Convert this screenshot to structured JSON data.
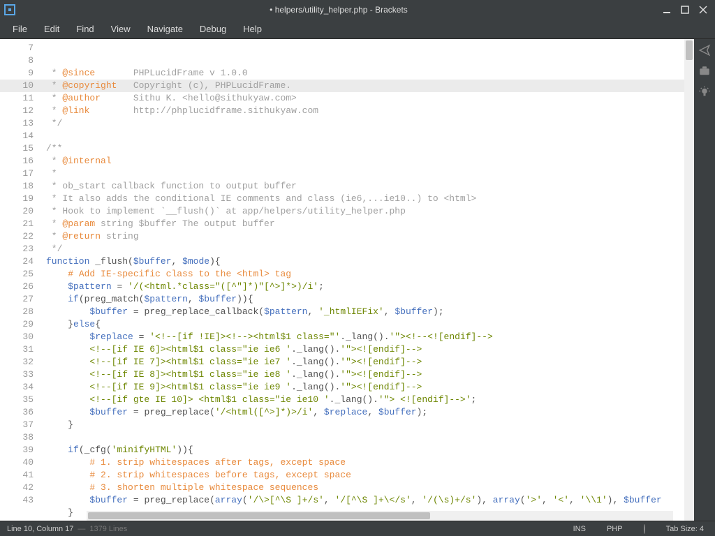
{
  "window": {
    "title": "• helpers/utility_helper.php - Brackets"
  },
  "menu": [
    "File",
    "Edit",
    "Find",
    "View",
    "Navigate",
    "Debug",
    "Help"
  ],
  "editor": {
    "first_line": 7,
    "last_line": 43,
    "active_line": 10,
    "lines": {
      "7": [
        [
          "c-gray",
          " * "
        ],
        [
          "c-orange",
          "@since"
        ],
        [
          "c-gray",
          "       PHPLucidFrame v 1.0.0"
        ]
      ],
      "8": [
        [
          "c-gray",
          " * "
        ],
        [
          "c-orange",
          "@copyright"
        ],
        [
          "c-gray",
          "   Copyright (c), PHPLucidFrame."
        ]
      ],
      "9": [
        [
          "c-gray",
          " * "
        ],
        [
          "c-orange",
          "@author"
        ],
        [
          "c-gray",
          "      Sithu K. <hello@sithukyaw.com>"
        ]
      ],
      "10": [
        [
          "c-gray",
          " * "
        ],
        [
          "c-orange",
          "@link"
        ],
        [
          "c-gray",
          "        http://phplucidframe.sithukyaw.com"
        ]
      ],
      "11": [
        [
          "c-gray",
          " */"
        ]
      ],
      "12": [
        [
          "c-gray",
          ""
        ]
      ],
      "13": [
        [
          "c-gray",
          "/**"
        ]
      ],
      "14": [
        [
          "c-gray",
          " * "
        ],
        [
          "c-orange",
          "@internal"
        ]
      ],
      "15": [
        [
          "c-gray",
          " *"
        ]
      ],
      "16": [
        [
          "c-gray",
          " * ob_start callback function to output buffer"
        ]
      ],
      "17": [
        [
          "c-gray",
          " * It also adds the conditional IE comments and class (ie6,...ie10..) to <html>"
        ]
      ],
      "18": [
        [
          "c-gray",
          " * Hook to implement `__flush()` at app/helpers/utility_helper.php"
        ]
      ],
      "19": [
        [
          "c-gray",
          " * "
        ],
        [
          "c-orange",
          "@param"
        ],
        [
          "c-gray",
          " string $buffer The output buffer"
        ]
      ],
      "20": [
        [
          "c-gray",
          " * "
        ],
        [
          "c-orange",
          "@return"
        ],
        [
          "c-gray",
          " string"
        ]
      ],
      "21": [
        [
          "c-gray",
          " */"
        ]
      ],
      "22": [
        [
          "c-kw",
          "function"
        ],
        [
          "c-black",
          " "
        ],
        [
          "c-fn",
          "_flush"
        ],
        [
          "c-black",
          "("
        ],
        [
          "c-var",
          "$buffer"
        ],
        [
          "c-black",
          ", "
        ],
        [
          "c-var",
          "$mode"
        ],
        [
          "c-black",
          "){"
        ]
      ],
      "23": [
        [
          "c-black",
          "    "
        ],
        [
          "c-orange",
          "# Add IE-specific class to the <html> tag"
        ]
      ],
      "24": [
        [
          "c-black",
          "    "
        ],
        [
          "c-var",
          "$pattern"
        ],
        [
          "c-black",
          " = "
        ],
        [
          "c-green",
          "'/(<html.*class=\"([^\"]*)\"[^>]*>)/i'"
        ],
        [
          "c-black",
          ";"
        ]
      ],
      "25": [
        [
          "c-black",
          "    "
        ],
        [
          "c-kw",
          "if"
        ],
        [
          "c-black",
          "("
        ],
        [
          "c-fn",
          "preg_match"
        ],
        [
          "c-black",
          "("
        ],
        [
          "c-var",
          "$pattern"
        ],
        [
          "c-black",
          ", "
        ],
        [
          "c-var",
          "$buffer"
        ],
        [
          "c-black",
          ")){"
        ]
      ],
      "26": [
        [
          "c-black",
          "        "
        ],
        [
          "c-var",
          "$buffer"
        ],
        [
          "c-black",
          " = "
        ],
        [
          "c-fn",
          "preg_replace_callback"
        ],
        [
          "c-black",
          "("
        ],
        [
          "c-var",
          "$pattern"
        ],
        [
          "c-black",
          ", "
        ],
        [
          "c-green",
          "'_htmlIEFix'"
        ],
        [
          "c-black",
          ", "
        ],
        [
          "c-var",
          "$buffer"
        ],
        [
          "c-black",
          ");"
        ]
      ],
      "27": [
        [
          "c-black",
          "    }"
        ],
        [
          "c-kw",
          "else"
        ],
        [
          "c-black",
          "{"
        ]
      ],
      "28": [
        [
          "c-black",
          "        "
        ],
        [
          "c-var",
          "$replace"
        ],
        [
          "c-black",
          " = "
        ],
        [
          "c-green",
          "'<!--[if !IE]><!--><html$1 class=\"'"
        ],
        [
          "c-black",
          "."
        ],
        [
          "c-fn",
          "_lang"
        ],
        [
          "c-black",
          "()."
        ],
        [
          "c-green",
          "'\"><!--<![endif]-->"
        ]
      ],
      "29": [
        [
          "c-green",
          "        <!--[if IE 6]><html$1 class=\"ie ie6 '"
        ],
        [
          "c-black",
          "."
        ],
        [
          "c-fn",
          "_lang"
        ],
        [
          "c-black",
          "()."
        ],
        [
          "c-green",
          "'\"><![endif]-->"
        ]
      ],
      "30": [
        [
          "c-green",
          "        <!--[if IE 7]><html$1 class=\"ie ie7 '"
        ],
        [
          "c-black",
          "."
        ],
        [
          "c-fn",
          "_lang"
        ],
        [
          "c-black",
          "()."
        ],
        [
          "c-green",
          "'\"><![endif]-->"
        ]
      ],
      "31": [
        [
          "c-green",
          "        <!--[if IE 8]><html$1 class=\"ie ie8 '"
        ],
        [
          "c-black",
          "."
        ],
        [
          "c-fn",
          "_lang"
        ],
        [
          "c-black",
          "()."
        ],
        [
          "c-green",
          "'\"><![endif]-->"
        ]
      ],
      "32": [
        [
          "c-green",
          "        <!--[if IE 9]><html$1 class=\"ie ie9 '"
        ],
        [
          "c-black",
          "."
        ],
        [
          "c-fn",
          "_lang"
        ],
        [
          "c-black",
          "()."
        ],
        [
          "c-green",
          "'\"><![endif]-->"
        ]
      ],
      "33": [
        [
          "c-green",
          "        <!--[if gte IE 10]> <html$1 class=\"ie ie10 '"
        ],
        [
          "c-black",
          "."
        ],
        [
          "c-fn",
          "_lang"
        ],
        [
          "c-black",
          "()."
        ],
        [
          "c-green",
          "'\"> <![endif]-->'"
        ],
        [
          "c-black",
          ";"
        ]
      ],
      "34": [
        [
          "c-black",
          "        "
        ],
        [
          "c-var",
          "$buffer"
        ],
        [
          "c-black",
          " = "
        ],
        [
          "c-fn",
          "preg_replace"
        ],
        [
          "c-black",
          "("
        ],
        [
          "c-green",
          "'/<html([^>]*)>/i'"
        ],
        [
          "c-black",
          ", "
        ],
        [
          "c-var",
          "$replace"
        ],
        [
          "c-black",
          ", "
        ],
        [
          "c-var",
          "$buffer"
        ],
        [
          "c-black",
          ");"
        ]
      ],
      "35": [
        [
          "c-black",
          "    }"
        ]
      ],
      "36": [
        [
          "c-black",
          ""
        ]
      ],
      "37": [
        [
          "c-black",
          "    "
        ],
        [
          "c-kw",
          "if"
        ],
        [
          "c-black",
          "("
        ],
        [
          "c-fn",
          "_cfg"
        ],
        [
          "c-black",
          "("
        ],
        [
          "c-green",
          "'minifyHTML'"
        ],
        [
          "c-black",
          ")){"
        ]
      ],
      "38": [
        [
          "c-black",
          "        "
        ],
        [
          "c-orange",
          "# 1. strip whitespaces after tags, except space"
        ]
      ],
      "39": [
        [
          "c-black",
          "        "
        ],
        [
          "c-orange",
          "# 2. strip whitespaces before tags, except space"
        ]
      ],
      "40": [
        [
          "c-black",
          "        "
        ],
        [
          "c-orange",
          "# 3. shorten multiple whitespace sequences"
        ]
      ],
      "41": [
        [
          "c-black",
          "        "
        ],
        [
          "c-var",
          "$buffer"
        ],
        [
          "c-black",
          " = "
        ],
        [
          "c-fn",
          "preg_replace"
        ],
        [
          "c-black",
          "("
        ],
        [
          "c-kw",
          "array"
        ],
        [
          "c-black",
          "("
        ],
        [
          "c-green",
          "'/\\>[^\\S ]+/s'"
        ],
        [
          "c-black",
          ", "
        ],
        [
          "c-green",
          "'/[^\\S ]+\\</s'"
        ],
        [
          "c-black",
          ", "
        ],
        [
          "c-green",
          "'/(\\s)+/s'"
        ],
        [
          "c-black",
          "), "
        ],
        [
          "c-kw",
          "array"
        ],
        [
          "c-black",
          "("
        ],
        [
          "c-green",
          "'>'"
        ],
        [
          "c-black",
          ", "
        ],
        [
          "c-green",
          "'<'"
        ],
        [
          "c-black",
          ", "
        ],
        [
          "c-green",
          "'\\\\1'"
        ],
        [
          "c-black",
          "), "
        ],
        [
          "c-var",
          "$buffer"
        ]
      ],
      "42": [
        [
          "c-black",
          "    }"
        ]
      ],
      "43": [
        [
          "c-black",
          ""
        ]
      ]
    }
  },
  "status": {
    "cursor": "Line 10, Column 17",
    "total": "1379 Lines",
    "ins": "INS",
    "lang": "PHP",
    "tabsize": "Tab Size: 4"
  },
  "sidebar_icons": [
    "live-preview-icon",
    "extension-manager-icon",
    "bulb-icon"
  ]
}
